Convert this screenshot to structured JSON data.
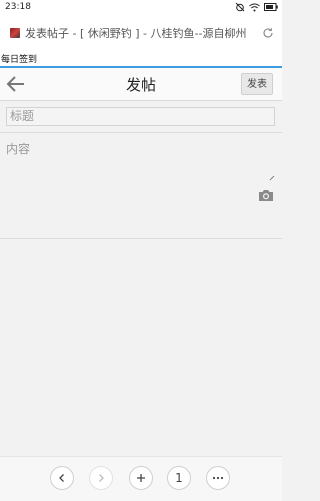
{
  "status_bar": {
    "time": "23:18",
    "icons": [
      "alarm-off-icon",
      "wifi-icon",
      "battery-icon"
    ]
  },
  "browser": {
    "page_title": "发表帖子 - [ 休闲野钓 ] - 八桂钓鱼--源自柳州",
    "signin_text": "每日签到",
    "accent": "#3d9be0"
  },
  "header": {
    "title": "发帖",
    "publish_label": "发表"
  },
  "form": {
    "title_placeholder": "标题",
    "content_placeholder": "内容"
  },
  "bottom_nav": {
    "tab_count": "1",
    "icons": [
      "back-icon",
      "forward-icon",
      "new-tab-icon",
      "tabs-count",
      "more-icon"
    ]
  }
}
